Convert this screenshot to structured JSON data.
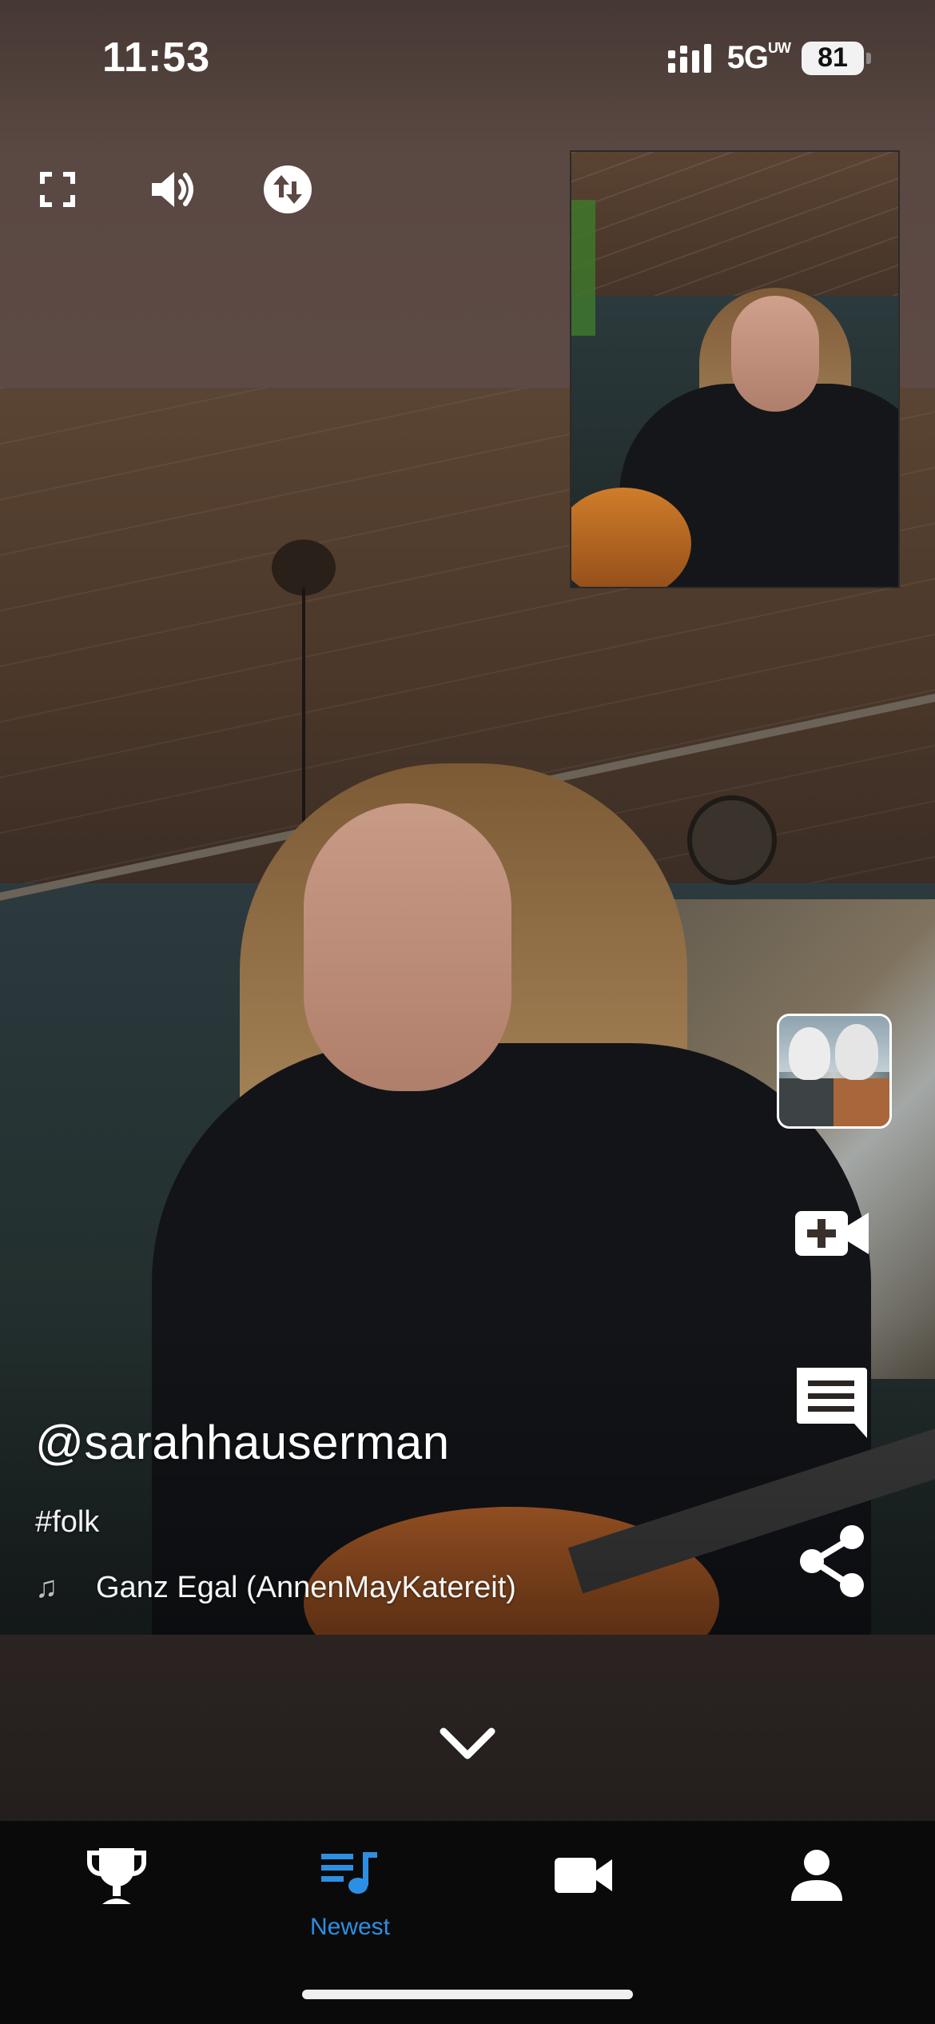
{
  "status_bar": {
    "time": "11:53",
    "network": "5G",
    "network_sup": "UW",
    "battery": "81"
  },
  "top_controls": [
    "fullscreen-icon",
    "volume-icon",
    "swap-icon"
  ],
  "post": {
    "username": "@sarahhauserman",
    "hashtag": "#folk",
    "song": "Ganz Egal (AnnenMayKatereit)"
  },
  "right_rail": [
    "album-thumbnail",
    "add-video-icon",
    "comment-icon",
    "share-icon"
  ],
  "bottom_nav": {
    "items": [
      {
        "icon": "trophy-icon",
        "label": ""
      },
      {
        "icon": "playlist-music-icon",
        "label": "Newest"
      },
      {
        "icon": "video-camera-icon",
        "label": ""
      },
      {
        "icon": "profile-icon",
        "label": ""
      }
    ],
    "active_index": 1
  },
  "colors": {
    "accent": "#2d8fe3",
    "nav_background": "#0a0a0a",
    "icon": "#ffffff"
  }
}
